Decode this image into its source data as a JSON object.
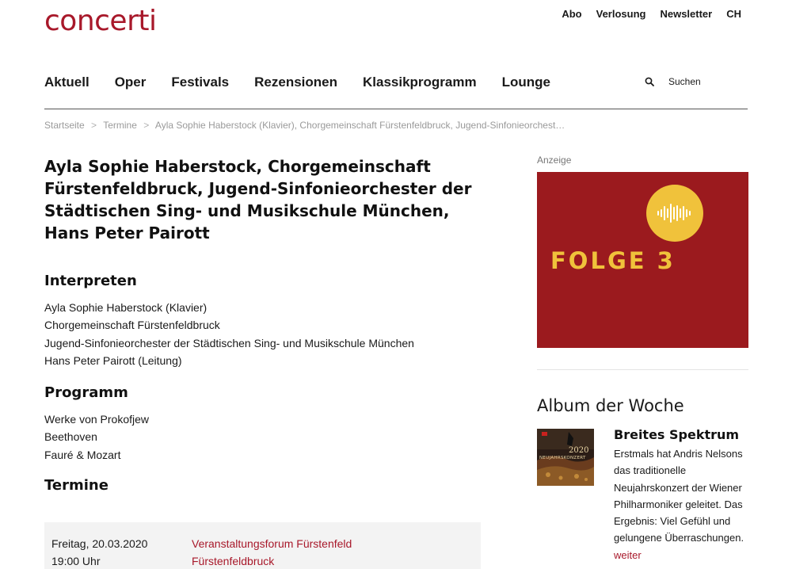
{
  "brand": {
    "logo": "concerti",
    "accent": "#a8182a"
  },
  "topnav": [
    "Abo",
    "Verlosung",
    "Newsletter",
    "CH"
  ],
  "mainnav": [
    "Aktuell",
    "Oper",
    "Festivals",
    "Rezensionen",
    "Klassikprogramm",
    "Lounge"
  ],
  "search": {
    "label": "Suchen",
    "icon": "search-icon"
  },
  "breadcrumb": [
    "Startseite",
    "Termine",
    "Ayla Sophie Haberstock (Klavier), Chorgemeinschaft Fürstenfeldbruck, Jugend-Sinfonieorchest…"
  ],
  "breadcrumb_separator": ">",
  "article": {
    "title_lines": [
      "Ayla Sophie Haberstock, Chorgemeinschaft",
      "Fürstenfeldbruck, Jugend-Sinfonieorchester der",
      "Städtischen Sing- und Musikschule München,",
      "Hans Peter Pairott"
    ],
    "interpreten_heading": "Interpreten",
    "interpreten": [
      "Ayla Sophie Haberstock (Klavier)",
      "Chorgemeinschaft Fürstenfeldbruck",
      "Jugend-Sinfonieorchester der Städtischen Sing- und Musikschule München",
      "Hans Peter Pairott (Leitung)"
    ],
    "programm_heading": "Programm",
    "programm": [
      "Werke von Prokofjew",
      "Beethoven",
      "Fauré & Mozart"
    ],
    "termine_heading": "Termine",
    "termine": [
      {
        "date": "Freitag, 20.03.2020",
        "time": "19:00 Uhr",
        "venue": "Veranstaltungsforum Fürstenfeld",
        "city": "Fürstenfeldbruck"
      }
    ]
  },
  "sidebar": {
    "ad_label": "Anzeige",
    "ad_text": "FOLGE 3",
    "ad_colors": {
      "background": "#9b1a1e",
      "accent": "#f0c23b"
    },
    "album_heading": "Album der Woche",
    "album": {
      "cover_text": "2020",
      "cover_subtext": "NEUJAHRSKONZERT",
      "title": "Breites Spektrum",
      "text": "Erstmals hat Andris Nelsons das traditionelle Neujahrskonzert der Wiener Philharmoniker geleitet. Das Ergebnis: Viel Gefühl und gelungene Überraschungen.",
      "more": "weiter"
    }
  }
}
